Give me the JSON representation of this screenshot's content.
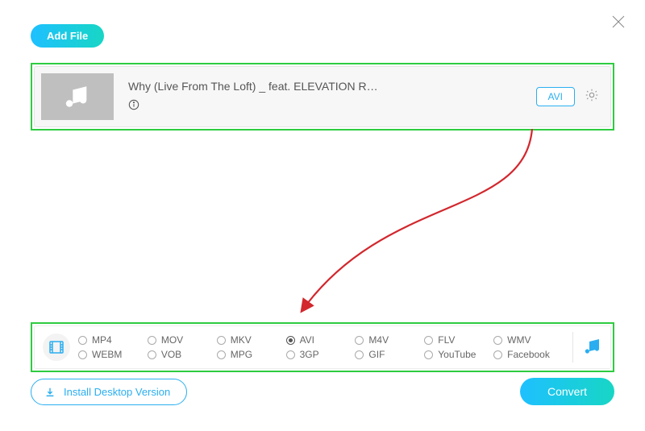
{
  "header": {
    "add_file_label": "Add File"
  },
  "file": {
    "title": "Why (Live From The Loft) _ feat. ELEVATION R…",
    "format_badge": "AVI"
  },
  "formats": {
    "selected": "AVI",
    "row1": [
      "MP4",
      "MOV",
      "MKV",
      "AVI",
      "M4V",
      "FLV",
      "WMV"
    ],
    "row2": [
      "WEBM",
      "VOB",
      "MPG",
      "3GP",
      "GIF",
      "YouTube",
      "Facebook"
    ]
  },
  "footer": {
    "install_label": "Install Desktop Version",
    "convert_label": "Convert"
  }
}
